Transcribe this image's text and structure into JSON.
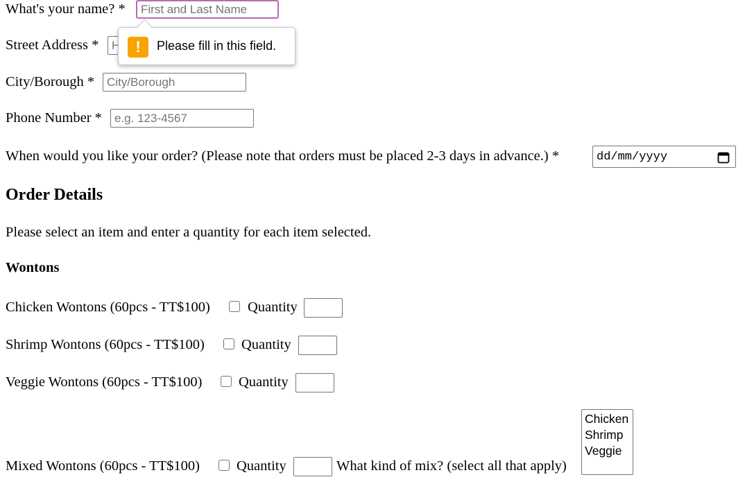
{
  "form": {
    "name_label": "What's your name? *",
    "name_placeholder": "First and Last Name",
    "street_label": "Street Address *",
    "street_placeholder": "H",
    "city_label": "City/Borough *",
    "city_placeholder": "City/Borough",
    "phone_label": "Phone Number *",
    "phone_placeholder": "e.g. 123-4567",
    "date_label": "When would you like your order? (Please note that orders must be placed 2-3 days in advance.) *",
    "date_value": "dd/mm/yyyy"
  },
  "validation_tooltip": {
    "message": "Please fill in this field.",
    "icon": "warning-icon",
    "icon_glyph": "!",
    "icon_color": "#f7a300"
  },
  "order": {
    "heading": "Order Details",
    "instructions": "Please select an item and enter a quantity for each item selected.",
    "wontons_heading": "Wontons",
    "items": [
      {
        "label": "Chicken Wontons (60pcs - TT$100)",
        "quantity_label": "Quantity",
        "checked": false
      },
      {
        "label": "Shrimp Wontons (60pcs - TT$100)",
        "quantity_label": "Quantity",
        "checked": false
      },
      {
        "label": "Veggie Wontons (60pcs - TT$100)",
        "quantity_label": "Quantity",
        "checked": false
      },
      {
        "label": "Mixed Wontons (60pcs - TT$100)",
        "quantity_label": "Quantity",
        "checked": false
      }
    ],
    "mix_label": "What kind of mix? (select all that apply)",
    "mix_options": [
      "Chicken",
      "Shrimp",
      "Veggie"
    ]
  },
  "colors": {
    "focus_border": "#b56cb8",
    "input_border": "#767676"
  }
}
